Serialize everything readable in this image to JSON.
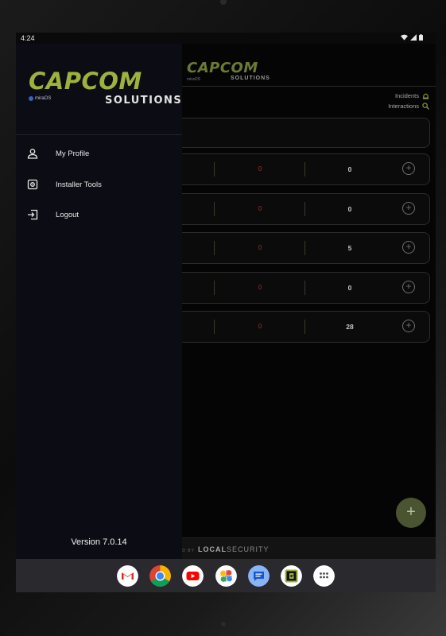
{
  "status_bar": {
    "time": "4:24"
  },
  "app": {
    "logo_word": "CAPCOM",
    "logo_sub": "SOLUTIONS",
    "logo_mira": "miraOS",
    "legend": {
      "incidents": "Incidents",
      "interactions": "Interactions"
    },
    "rows": [
      {
        "incidents": "0",
        "interactions": "0"
      },
      {
        "incidents": "0",
        "interactions": "0"
      },
      {
        "incidents": "0",
        "interactions": "5"
      },
      {
        "incidents": "0",
        "interactions": "0"
      },
      {
        "incidents": "0",
        "interactions": "28"
      }
    ],
    "fab_label": "+",
    "footer": {
      "prefix": "ERED BY",
      "brand_bold": "LOCAL",
      "brand_rest": "SECURITY"
    }
  },
  "drawer": {
    "logo_word": "CAPCOM",
    "logo_sub": "SOLUTIONS",
    "logo_mira": "miraOS",
    "menu": [
      {
        "label": "My Profile",
        "icon": "person-icon"
      },
      {
        "label": "Installer Tools",
        "icon": "gear-icon"
      },
      {
        "label": "Logout",
        "icon": "logout-icon"
      }
    ],
    "version": "Version 7.0.14"
  },
  "dock": {
    "apps": [
      "gmail-icon",
      "chrome-icon",
      "youtube-icon",
      "photos-icon",
      "messages-icon",
      "capcom-app-icon",
      "app-drawer-icon"
    ]
  },
  "colors": {
    "accent_green": "#9bb33c",
    "drawer_bg": "#0c0c14",
    "incident_red": "#a0302a"
  }
}
